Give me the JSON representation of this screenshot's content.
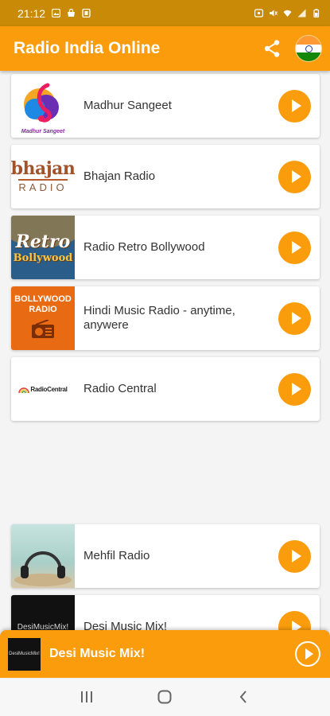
{
  "status_bar": {
    "time": "21:12"
  },
  "app_bar": {
    "title": "Radio India Online"
  },
  "stations": [
    {
      "name": "Madhur Sangeet",
      "logo_text": "Madhur Sangeet"
    },
    {
      "name": "Bhajan Radio",
      "logo_text": "bhajan",
      "logo_sub": "RADIO"
    },
    {
      "name": "Radio Retro Bollywood",
      "logo_text": "Retro",
      "logo_sub": "Bollywood"
    },
    {
      "name": "Hindi Music Radio - anytime, anywere",
      "logo_text": "BOLLYWOOD",
      "logo_sub": "RADIO"
    },
    {
      "name": "Radio Central",
      "logo_text": "RadioCentral"
    },
    {
      "name": "Mehfil Radio"
    },
    {
      "name": "Desi Music Mix!",
      "logo_text": "DesiMusicMix!"
    }
  ],
  "now_playing": {
    "title": "Desi Music Mix!",
    "logo_text": "DesiMusicMix!"
  },
  "colors": {
    "accent": "#fb9c0c",
    "status_bar": "#c98a07"
  }
}
